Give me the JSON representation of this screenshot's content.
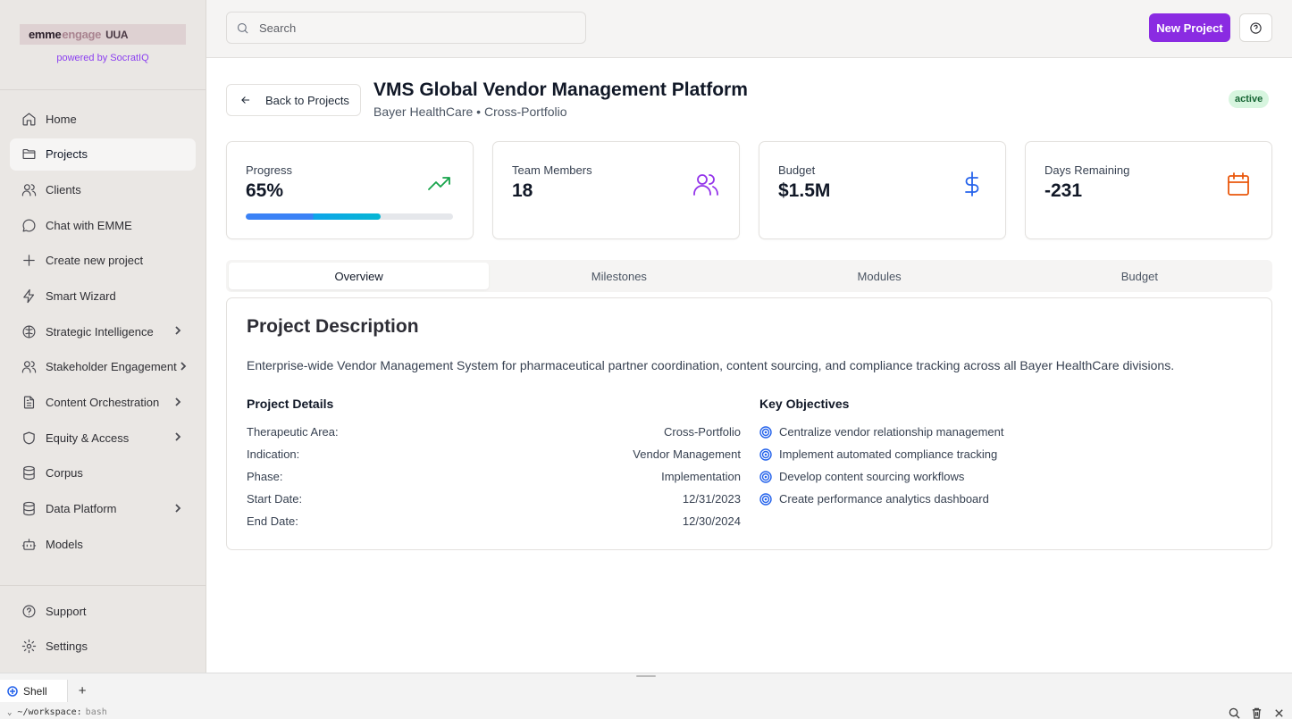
{
  "brand": {
    "logo_text_a": "emme",
    "logo_text_b": "engage",
    "logo_mark": "UUA",
    "powered_by": "powered by SocratIQ"
  },
  "sidebar": {
    "items": [
      {
        "label": "Home",
        "icon": "home-icon"
      },
      {
        "label": "Projects",
        "icon": "folder-icon",
        "active": true
      },
      {
        "label": "Clients",
        "icon": "users-icon"
      },
      {
        "label": "Chat with EMME",
        "icon": "chat-icon"
      },
      {
        "label": "Create new project",
        "icon": "plus-icon"
      },
      {
        "label": "Smart Wizard",
        "icon": "zap-icon"
      },
      {
        "label": "Strategic Intelligence",
        "icon": "brain-icon",
        "has_submenu": true
      },
      {
        "label": "Stakeholder Engagement",
        "icon": "users-icon",
        "has_submenu": true
      },
      {
        "label": "Content Orchestration",
        "icon": "file-text-icon",
        "has_submenu": true
      },
      {
        "label": "Equity & Access",
        "icon": "shield-icon",
        "has_submenu": true
      },
      {
        "label": "Corpus",
        "icon": "database-icon"
      },
      {
        "label": "Data Platform",
        "icon": "database-icon",
        "has_submenu": true
      },
      {
        "label": "Models",
        "icon": "bot-icon"
      }
    ],
    "bottom_items": [
      {
        "label": "Support",
        "icon": "help-circle-icon"
      },
      {
        "label": "Settings",
        "icon": "gear-icon"
      }
    ]
  },
  "topbar": {
    "search_placeholder": "Search",
    "new_project_label": "New Project"
  },
  "project": {
    "back_label": "Back to Projects",
    "title": "VMS Global Vendor Management Platform",
    "subtitle": "Bayer HealthCare • Cross-Portfolio",
    "status": "active"
  },
  "stats": {
    "progress": {
      "label": "Progress",
      "value": "65%",
      "fraction": 0.65
    },
    "team": {
      "label": "Team Members",
      "value": "18"
    },
    "budget": {
      "label": "Budget",
      "value": "$1.5M"
    },
    "days": {
      "label": "Days Remaining",
      "value": "-231"
    }
  },
  "tabs": [
    "Overview",
    "Milestones",
    "Modules",
    "Budget"
  ],
  "description": {
    "title": "Project Description",
    "text": "Enterprise-wide Vendor Management System for pharmaceutical partner coordination, content sourcing, and compliance tracking across all Bayer HealthCare divisions.",
    "details_title": "Project Details",
    "details": [
      {
        "label": "Therapeutic Area:",
        "value": "Cross-Portfolio"
      },
      {
        "label": "Indication:",
        "value": "Vendor Management"
      },
      {
        "label": "Phase:",
        "value": "Implementation"
      },
      {
        "label": "Start Date:",
        "value": "12/31/2023"
      },
      {
        "label": "End Date:",
        "value": "12/30/2024"
      }
    ],
    "objectives_title": "Key Objectives",
    "objectives": [
      "Centralize vendor relationship management",
      "Implement automated compliance tracking",
      "Develop content sourcing workflows",
      "Create performance analytics dashboard"
    ]
  },
  "shell": {
    "tab_label": "Shell",
    "path": "~/workspace:",
    "program": "bash"
  },
  "colors": {
    "accent": "#8a2be2",
    "progress_icon": "#16a34a",
    "team_icon": "#9333ea",
    "budget_icon": "#2563eb",
    "days_icon": "#ea580c",
    "objective_icon": "#2563eb"
  }
}
